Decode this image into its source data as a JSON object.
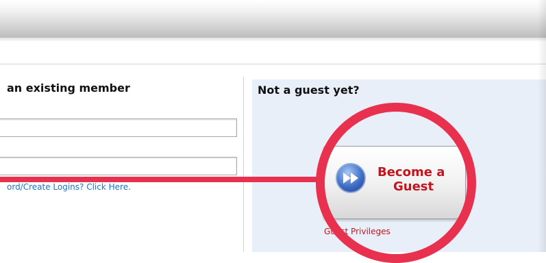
{
  "login": {
    "title": "an existing member",
    "help_link": "ord/Create Logins? Click Here."
  },
  "guest": {
    "title": "Not a guest yet?",
    "button_line1": "Become a",
    "button_line2": "Guest",
    "privileges_link": "Guest Privileges"
  },
  "icons": {
    "play": "fast-forward-icon"
  },
  "colors": {
    "accent_red": "#c2161f",
    "highlight": "#e8314e",
    "link_blue": "#1a73c8",
    "guest_panel_bg": "#e9eff8"
  }
}
